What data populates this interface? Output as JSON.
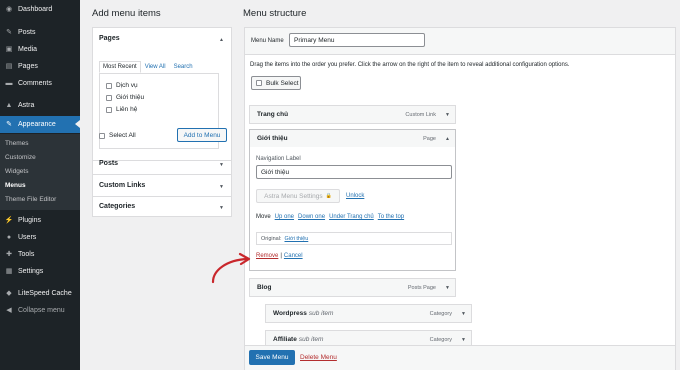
{
  "sidebar": {
    "items": [
      {
        "label": "Dashboard",
        "icon": "dashboard-icon",
        "glyph": "◉"
      },
      {
        "label": "Posts",
        "icon": "pin-icon",
        "glyph": "✎"
      },
      {
        "label": "Media",
        "icon": "media-icon",
        "glyph": "▣"
      },
      {
        "label": "Pages",
        "icon": "page-icon",
        "glyph": "▤"
      },
      {
        "label": "Comments",
        "icon": "comment-icon",
        "glyph": "▬"
      },
      {
        "label": "Astra",
        "icon": "astra-icon",
        "glyph": "▲"
      },
      {
        "label": "Appearance",
        "icon": "brush-icon",
        "glyph": "✎"
      },
      {
        "label": "Plugins",
        "icon": "plugin-icon",
        "glyph": "⚡"
      },
      {
        "label": "Users",
        "icon": "users-icon",
        "glyph": "●"
      },
      {
        "label": "Tools",
        "icon": "wrench-icon",
        "glyph": "✚"
      },
      {
        "label": "Settings",
        "icon": "settings-icon",
        "glyph": "▦"
      },
      {
        "label": "LiteSpeed Cache",
        "icon": "litespeed-icon",
        "glyph": "◆"
      },
      {
        "label": "Collapse menu",
        "icon": "collapse-icon",
        "glyph": "◀"
      }
    ],
    "sub_items": [
      "Themes",
      "Customize",
      "Widgets",
      "Menus",
      "Theme File Editor"
    ]
  },
  "add_items": {
    "heading": "Add menu items",
    "pages": {
      "title": "Pages",
      "tabs": [
        "Most Recent",
        "View All",
        "Search"
      ],
      "pages_list": [
        "Dịch vụ",
        "Giới thiệu",
        "Liên hệ"
      ],
      "select_all": "Select All",
      "add_button": "Add to Menu"
    },
    "sections": [
      "Posts",
      "Custom Links",
      "Categories"
    ]
  },
  "structure": {
    "heading": "Menu structure",
    "menu_name_label": "Menu Name",
    "menu_name_value": "Primary Menu",
    "instructions": "Drag the items into the order you prefer. Click the arrow on the right of the item to reveal additional configuration options.",
    "bulk_select": "Bulk Select",
    "items": {
      "trang_chu": {
        "title": "Trang chủ",
        "type": "Custom Link"
      },
      "gioi_thieu": {
        "title": "Giới thiệu",
        "type": "Page"
      },
      "blog": {
        "title": "Blog",
        "type": "Posts Page"
      },
      "wordpress": {
        "title": "Wordpress",
        "sub": "sub item",
        "type": "Category"
      },
      "affiliate": {
        "title": "Affiliate",
        "sub": "sub item",
        "type": "Category"
      }
    },
    "editor": {
      "nav_label_caption": "Navigation Label",
      "nav_label_value": "Giới thiệu",
      "astra_settings": "Astra Menu Settings",
      "unlock": "Unlock",
      "move_label": "Move",
      "move_up": "Up one",
      "move_down": "Down one",
      "move_under": "Under Trang chủ",
      "move_top": "To the top",
      "original_label": "Original:",
      "original_link": "Giới thiệu",
      "remove": "Remove",
      "separator": "|",
      "cancel": "Cancel"
    },
    "save_button": "Save Menu",
    "delete_link": "Delete Menu"
  },
  "colors": {
    "accent": "#2271b1",
    "sidebar": "#1d2327",
    "danger": "#b32d2e",
    "arrow": "#c9272c"
  }
}
